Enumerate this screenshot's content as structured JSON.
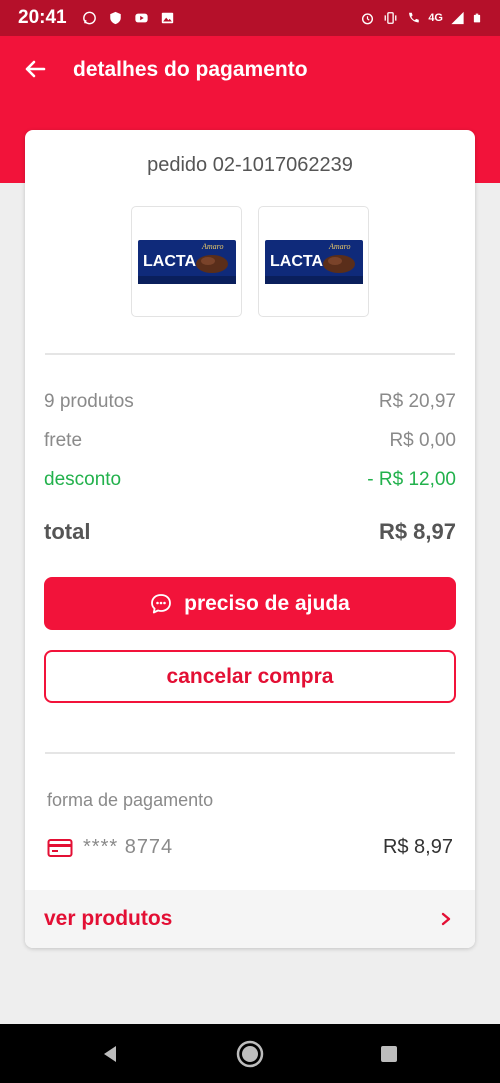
{
  "status_bar": {
    "time": "20:41",
    "network": "4G",
    "icons": [
      "whatsapp-icon",
      "shield-icon",
      "youtube-icon",
      "image-icon",
      "alarm-icon",
      "vibrate-icon",
      "call-4g-icon",
      "signal-icon",
      "battery-icon"
    ]
  },
  "header": {
    "title": "detalhes do pagamento",
    "back_icon": "arrow-left-icon"
  },
  "order": {
    "id_label": "pedido 02-1017062239",
    "products": [
      {
        "brand": "LACTA",
        "flavor": "Amaro"
      },
      {
        "brand": "LACTA",
        "flavor": "Amaro"
      }
    ]
  },
  "summary": {
    "products_label": "9 produtos",
    "products_value": "R$ 20,97",
    "shipping_label": "frete",
    "shipping_value": "R$ 0,00",
    "discount_label": "desconto",
    "discount_value": "- R$ 12,00",
    "total_label": "total",
    "total_value": "R$ 8,97"
  },
  "actions": {
    "help_label": "preciso de ajuda",
    "cancel_label": "cancelar compra"
  },
  "payment": {
    "section_label": "forma de pagamento",
    "card_masked": "**** 8774",
    "amount": "R$ 8,97"
  },
  "footer_link": {
    "label": "ver produtos"
  },
  "colors": {
    "primary": "#f2133a",
    "status_bar": "#b5102a",
    "discount": "#22b14c",
    "background": "#eeeeee"
  }
}
